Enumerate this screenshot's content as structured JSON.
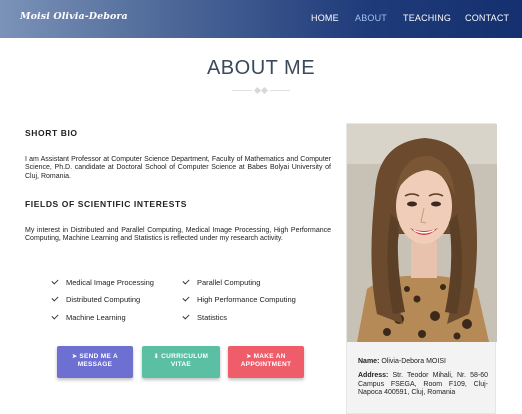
{
  "navbar": {
    "brand": "Moisi Olivia-Debora",
    "items": [
      {
        "label": "HOME",
        "active": false
      },
      {
        "label": "ABOUT",
        "active": true
      },
      {
        "label": "TEACHING",
        "active": false
      },
      {
        "label": "CONTACT",
        "active": false
      }
    ],
    "active_color": "#9ec4ee"
  },
  "page": {
    "title": "ABOUT ME"
  },
  "bio": {
    "heading": "SHORT BIO",
    "text": "I am Assistant Professor at Computer Science Department, Faculty of Mathematics and Computer Science, Ph.D. candidate at Doctoral School of Computer Science at Babes Bolyai University of Cluj, Romania."
  },
  "fields": {
    "heading": "FIELDS OF SCIENTIFIC INTERESTS",
    "text": "My interest in Distributed and Parallel Computing, Medical Image Processing, High Performance Computing, Machine Learning and Statistics is reflected under my research activity.",
    "items": [
      "Medical Image Processing",
      "Parallel Computing",
      "Distributed Computing",
      "High Performance Computing",
      "Machine Learning",
      "Statistics"
    ]
  },
  "buttons": {
    "message": {
      "line1": "SEND ME A",
      "line2": "MESSAGE",
      "color": "#6d6fd1",
      "icon": "paper-plane-icon"
    },
    "cv": {
      "line1": "CURRICULUM",
      "line2": "VITAE",
      "color": "#5bc0a3",
      "icon": "download-icon"
    },
    "appointment": {
      "line1": "MAKE AN",
      "line2": "APPOINTMENT",
      "color": "#ef5d6a",
      "icon": "paper-plane-icon"
    }
  },
  "profile": {
    "name_label": "Name:",
    "name": "Olivia-Debora MOISI",
    "address_label": "Address:",
    "address": "Str. Teodor Mihali, Nr. 58-60 Campus FSEGA, Room F109, Cluj-Napoca 400591, Cluj, Romania"
  }
}
